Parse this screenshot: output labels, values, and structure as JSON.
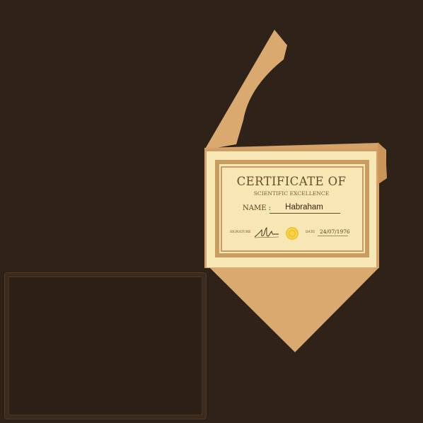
{
  "certificate": {
    "title": "CERTIFICATE OF",
    "subtitle": "SCIENTIFIC EXCELLENCE",
    "name_label": "NAME :",
    "name_value": "Habraham",
    "signature_label": "SIGNATURE",
    "date_label": "DATE",
    "date_value": "24/07/1976"
  },
  "colors": {
    "background": "#2f2218",
    "envelope": "#d9a96f",
    "envelope_shadow": "#c79559",
    "certificate_paper": "#f6e7b4",
    "certificate_border": "#c99d62",
    "seal": "#f2c42b"
  },
  "icons": {
    "seal": "gold-seal-icon",
    "signature": "signature-scribble"
  }
}
